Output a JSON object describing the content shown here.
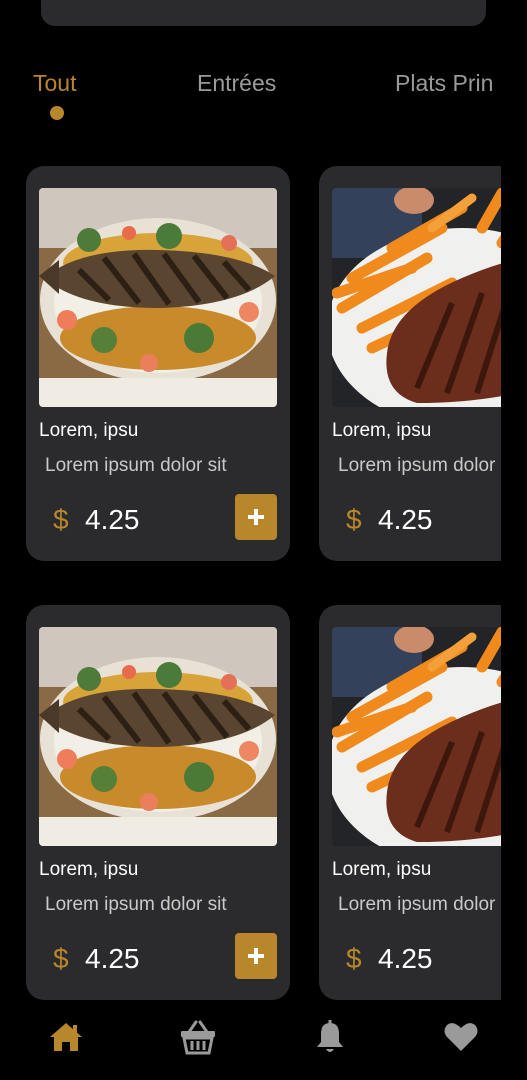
{
  "tabs": [
    {
      "label": "Tout",
      "active": true
    },
    {
      "label": "Entrées",
      "active": false
    },
    {
      "label": "Plats Prin",
      "active": false
    }
  ],
  "cards": [
    {
      "title": "Lorem, ipsu",
      "subtitle": "Lorem ipsum dolor sit",
      "currency": "$",
      "price": "4.25",
      "image": "grilled-fish-icon"
    },
    {
      "title": "Lorem, ipsu",
      "subtitle": "Lorem ipsum dolor sit",
      "currency": "$",
      "price": "4.25",
      "image": "ribs-fries-icon"
    },
    {
      "title": "Lorem, ipsu",
      "subtitle": "Lorem ipsum dolor sit",
      "currency": "$",
      "price": "4.25",
      "image": "grilled-fish-icon"
    },
    {
      "title": "Lorem, ipsu",
      "subtitle": "Lorem ipsum dolor sit",
      "currency": "$",
      "price": "4.25",
      "image": "ribs-fries-icon"
    }
  ],
  "nav": [
    {
      "icon": "home-icon",
      "active": true
    },
    {
      "icon": "basket-icon",
      "active": false
    },
    {
      "icon": "bell-icon",
      "active": false
    },
    {
      "icon": "heart-icon",
      "active": false
    }
  ],
  "colors": {
    "accent": "#b8862b",
    "card_bg": "#2b2a2c",
    "inactive": "#9a9a9a",
    "background": "#000000"
  }
}
